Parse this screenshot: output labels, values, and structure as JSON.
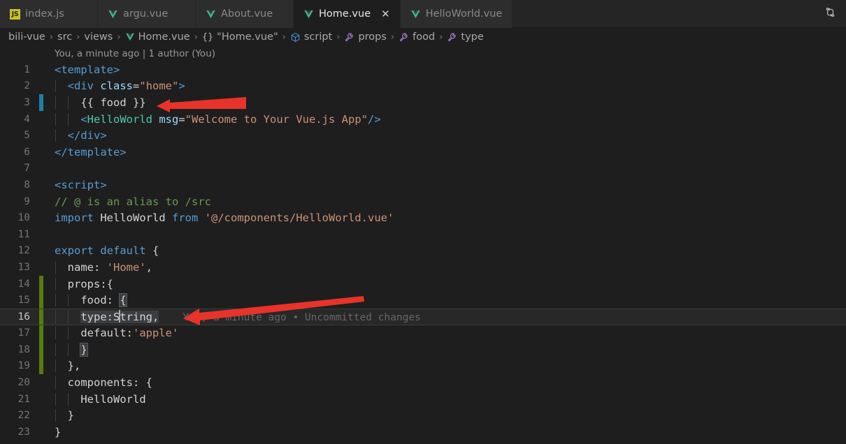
{
  "window": {
    "editor_background": "#1e1e1e",
    "tabbar_background": "#252526"
  },
  "tabs": [
    {
      "label": "index.js",
      "icon": "js-file-icon",
      "active": false,
      "dirty": false
    },
    {
      "label": "argu.vue",
      "icon": "vue-file-icon",
      "active": false,
      "dirty": false
    },
    {
      "label": "About.vue",
      "icon": "vue-file-icon",
      "active": false,
      "dirty": false
    },
    {
      "label": "Home.vue",
      "icon": "vue-file-icon",
      "active": true,
      "dirty": false,
      "close_glyph": "✕"
    },
    {
      "label": "HelloWorld.vue",
      "icon": "vue-file-icon",
      "active": false,
      "dirty": false
    }
  ],
  "tabbar_actions": [
    {
      "name": "split-editor-icon",
      "label": ""
    }
  ],
  "breadcrumb": [
    {
      "label": "bili-vue",
      "icon": null
    },
    {
      "label": "src",
      "icon": null
    },
    {
      "label": "views",
      "icon": null
    },
    {
      "label": "Home.vue",
      "icon": "vue-file-icon"
    },
    {
      "label": "\"Home.vue\"",
      "icon": "braces-icon"
    },
    {
      "label": "script",
      "icon": "module-cube-icon"
    },
    {
      "label": "props",
      "icon": "wrench-icon"
    },
    {
      "label": "food",
      "icon": "wrench-icon"
    },
    {
      "label": "type",
      "icon": "wrench-icon"
    }
  ],
  "breadcrumb_separator": "›",
  "codelens": "You, a minute ago | 1 author (You)",
  "inline_blame": "You, a minute ago • Uncommitted changes",
  "editor": {
    "cursor_line": 16,
    "selection_text": "type:String,",
    "lines": [
      {
        "n": 1,
        "gutter": "none",
        "indent_guides": 0
      },
      {
        "n": 2,
        "gutter": "none",
        "indent_guides": 1
      },
      {
        "n": 3,
        "gutter": "cyan",
        "indent_guides": 2
      },
      {
        "n": 4,
        "gutter": "none",
        "indent_guides": 2
      },
      {
        "n": 5,
        "gutter": "none",
        "indent_guides": 1
      },
      {
        "n": 6,
        "gutter": "none",
        "indent_guides": 0
      },
      {
        "n": 7,
        "gutter": "none",
        "indent_guides": 0
      },
      {
        "n": 8,
        "gutter": "none",
        "indent_guides": 0
      },
      {
        "n": 9,
        "gutter": "none",
        "indent_guides": 0
      },
      {
        "n": 10,
        "gutter": "none",
        "indent_guides": 0
      },
      {
        "n": 11,
        "gutter": "none",
        "indent_guides": 0
      },
      {
        "n": 12,
        "gutter": "none",
        "indent_guides": 0
      },
      {
        "n": 13,
        "gutter": "none",
        "indent_guides": 1
      },
      {
        "n": 14,
        "gutter": "green",
        "indent_guides": 1
      },
      {
        "n": 15,
        "gutter": "green",
        "indent_guides": 2
      },
      {
        "n": 16,
        "gutter": "green",
        "indent_guides": 2
      },
      {
        "n": 17,
        "gutter": "green",
        "indent_guides": 2
      },
      {
        "n": 18,
        "gutter": "green",
        "indent_guides": 2
      },
      {
        "n": 19,
        "gutter": "green",
        "indent_guides": 1
      },
      {
        "n": 20,
        "gutter": "none",
        "indent_guides": 1
      },
      {
        "n": 21,
        "gutter": "none",
        "indent_guides": 2
      },
      {
        "n": 22,
        "gutter": "none",
        "indent_guides": 1
      },
      {
        "n": 23,
        "gutter": "none",
        "indent_guides": 0
      }
    ],
    "source_text": [
      "<template>",
      "  <div class=\"home\">",
      "    {{ food }}",
      "    <HelloWorld msg=\"Welcome to Your Vue.js App\"/>",
      "  </div>",
      "</template>",
      "",
      "<script>",
      "// @ is an alias to /src",
      "import HelloWorld from '@/components/HelloWorld.vue'",
      "",
      "export default {",
      "  name: 'Home',",
      "  props:{",
      "    food: {",
      "    type:String,",
      "    default:'apple'",
      "    }",
      "  },",
      "  components: {",
      "    HelloWorld",
      "  }",
      "}"
    ]
  },
  "annotations": [
    {
      "name": "red-arrow-1",
      "points_at": "{{ food }}",
      "color": "#e8332a"
    },
    {
      "name": "red-arrow-2",
      "points_at": "type:String,",
      "color": "#e8332a"
    }
  ]
}
